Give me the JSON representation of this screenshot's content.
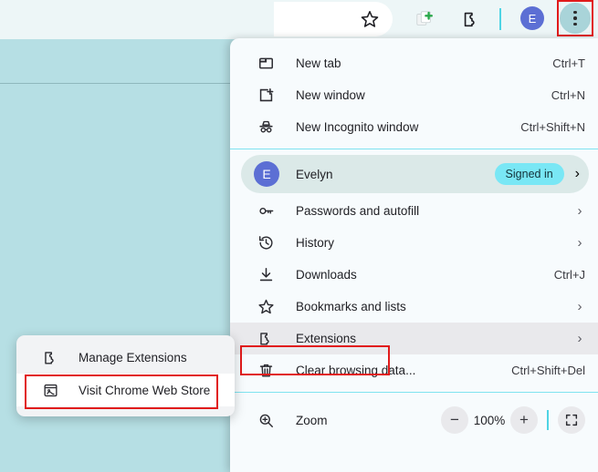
{
  "theme": {
    "page_bg": "#b6dfe4",
    "toolbar_bg": "#edf6f7",
    "menu_bg": "#f7fbfd",
    "separator": "#7fe3f0",
    "highlight_red": "#e11b1b",
    "avatar": "#5c6fd4",
    "badge_cyan": "#79e7f5",
    "hover_gray": "#e9e9ec"
  },
  "toolbar": {
    "bookmark_star": "bookmark-star-icon",
    "add_to_group": "add-tab-group-icon",
    "extensions": "extensions-puzzle-icon",
    "profile_initial": "E",
    "menu_button": "three-dot-menu-icon"
  },
  "menu": {
    "groups": [
      {
        "items": [
          {
            "icon": "new-tab-icon",
            "label": "New tab",
            "accel": "Ctrl+T",
            "chevron": false
          },
          {
            "icon": "new-window-icon",
            "label": "New window",
            "accel": "Ctrl+N",
            "chevron": false
          },
          {
            "icon": "incognito-icon",
            "label": "New Incognito window",
            "accel": "Ctrl+Shift+N",
            "chevron": false
          }
        ]
      }
    ],
    "profile": {
      "initial": "E",
      "name": "Evelyn",
      "status_badge": "Signed in",
      "chevron": "›"
    },
    "items": [
      {
        "icon": "key-icon",
        "label": "Passwords and autofill",
        "accel": "",
        "chevron": true,
        "hovered": false
      },
      {
        "icon": "history-icon",
        "label": "History",
        "accel": "",
        "chevron": true,
        "hovered": false
      },
      {
        "icon": "download-icon",
        "label": "Downloads",
        "accel": "Ctrl+J",
        "chevron": false,
        "hovered": false
      },
      {
        "icon": "star-icon",
        "label": "Bookmarks and lists",
        "accel": "",
        "chevron": true,
        "hovered": false
      },
      {
        "icon": "puzzle-icon",
        "label": "Extensions",
        "accel": "",
        "chevron": true,
        "hovered": true
      },
      {
        "icon": "trash-icon",
        "label": "Clear browsing data...",
        "accel": "Ctrl+Shift+Del",
        "chevron": false,
        "hovered": false
      }
    ],
    "zoom": {
      "icon": "zoom-in-icon",
      "label": "Zoom",
      "minus": "−",
      "level": "100%",
      "plus": "+",
      "fullscreen": "fullscreen-icon"
    },
    "chevron_glyph": "›"
  },
  "submenu": {
    "items": [
      {
        "icon": "puzzle-icon",
        "label": "Manage Extensions",
        "highlighted": false
      },
      {
        "icon": "webstore-icon",
        "label": "Visit Chrome Web Store",
        "highlighted": true
      }
    ]
  }
}
